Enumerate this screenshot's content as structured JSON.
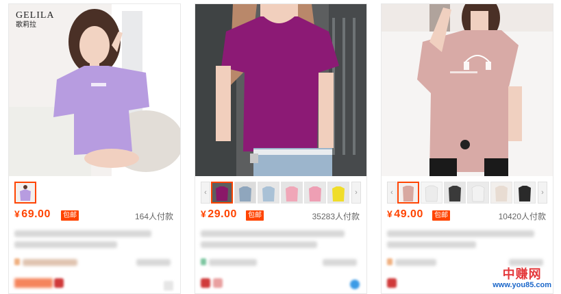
{
  "products": [
    {
      "brand": {
        "en": "GELILA",
        "zh": "歌莉拉"
      },
      "price": "69.00",
      "badge": "包邮",
      "sales": "164人付款",
      "thumb_colors": [
        "#b9a2d3"
      ],
      "shirt_color": "#b79ce0"
    },
    {
      "price": "29.00",
      "badge": "包邮",
      "sales": "35283人付款",
      "thumb_colors": [
        "#8a1868",
        "#8fa6bd",
        "#a9c1d6",
        "#f0a7b8",
        "#ee9fb4",
        "#f0dd2a"
      ],
      "shirt_color": "#8c1a75"
    },
    {
      "price": "49.00",
      "badge": "包邮",
      "sales": "10420人付款",
      "thumb_colors": [
        "#d8a8a0",
        "#ececec",
        "#3a3a3a",
        "#f2f2f2",
        "#e8dcd2",
        "#2a2a2a"
      ],
      "shirt_color": "#d8aaa6"
    }
  ],
  "currency": "¥",
  "watermark": {
    "line1": "中赚网",
    "line2": "www.you85.com"
  },
  "colors": {
    "accent": "#ff4400",
    "watermark_red": "#e4393c",
    "watermark_blue": "#1a66c9"
  }
}
